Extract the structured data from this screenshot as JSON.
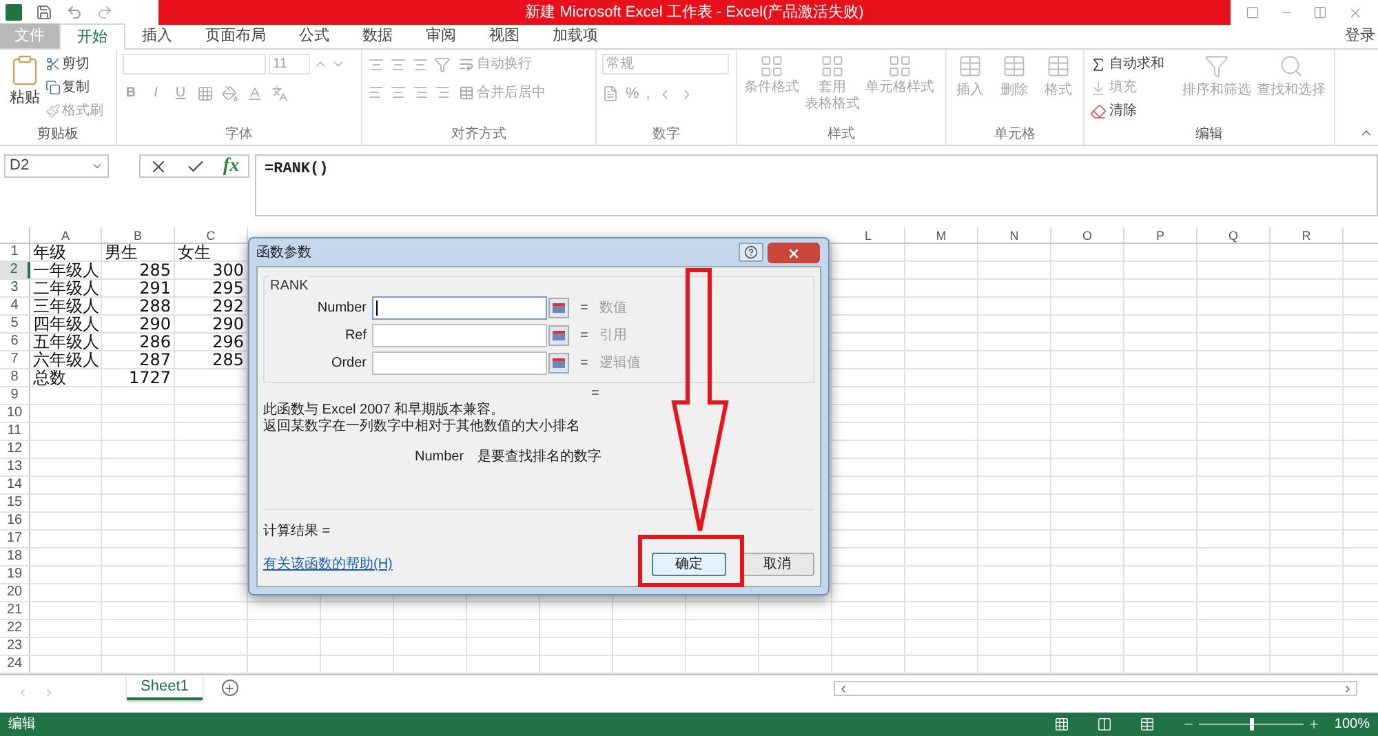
{
  "title_bar": {
    "title": "新建 Microsoft Excel 工作表 - Excel(产品激活失败)"
  },
  "tabs": [
    {
      "label": "文件",
      "selected": false,
      "kind": "file"
    },
    {
      "label": "开始",
      "selected": true,
      "kind": "tab"
    },
    {
      "label": "插入",
      "selected": false,
      "kind": "tab"
    },
    {
      "label": "页面布局",
      "selected": false,
      "kind": "tab"
    },
    {
      "label": "公式",
      "selected": false,
      "kind": "tab"
    },
    {
      "label": "数据",
      "selected": false,
      "kind": "tab"
    },
    {
      "label": "审阅",
      "selected": false,
      "kind": "tab"
    },
    {
      "label": "视图",
      "selected": false,
      "kind": "tab"
    },
    {
      "label": "加载项",
      "selected": false,
      "kind": "tab"
    }
  ],
  "account": "登录",
  "ribbon": {
    "clipboard": {
      "label": "剪贴板",
      "paste": {
        "label": "粘贴",
        "disabled": false
      },
      "items": [
        {
          "label": "剪切",
          "disabled": false
        },
        {
          "label": "复制",
          "disabled": false
        },
        {
          "label": "格式刷",
          "disabled": true
        }
      ]
    },
    "font": {
      "label": "字体",
      "disabled": true,
      "size": "11",
      "style_buttons": [
        "B",
        "I",
        "U"
      ]
    },
    "alignment": {
      "label": "对齐方式",
      "disabled": true,
      "items": [
        "自动换行",
        "合并后居中"
      ]
    },
    "number": {
      "label": "数字",
      "disabled": true,
      "format": "常规",
      "symbols": [
        "%",
        ","
      ]
    },
    "styles": {
      "label": "样式",
      "disabled": true,
      "items": [
        {
          "lines": [
            "条件格式"
          ]
        },
        {
          "lines": [
            "套用",
            "表格格式"
          ]
        },
        {
          "lines": [
            "单元格样式"
          ]
        }
      ]
    },
    "cells": {
      "label": "单元格",
      "disabled": true,
      "items": [
        "插入",
        "删除",
        "格式"
      ]
    },
    "editing": {
      "label": "编辑",
      "items": [
        {
          "label": "自动求和",
          "disabled": false
        },
        {
          "label": "填充",
          "disabled": true
        },
        {
          "label": "清除",
          "disabled": false
        }
      ],
      "big_items": [
        {
          "label": "排序和筛选",
          "disabled": true
        },
        {
          "label": "查找和选择",
          "disabled": true
        }
      ]
    }
  },
  "formula_bar": {
    "name_box": "D2",
    "function_label": "fx",
    "formula": "=RANK()"
  },
  "sheet": {
    "column_headers_left": [
      "A",
      "B",
      "C"
    ],
    "column_headers_right": [
      "L",
      "M",
      "N",
      "O",
      "P",
      "Q",
      "R"
    ],
    "rows": [
      {
        "number": "1",
        "selected": false,
        "cells": [
          {
            "text": "年级",
            "kind": "text"
          },
          {
            "text": "男生",
            "kind": "text"
          },
          {
            "text": "女生",
            "kind": "text"
          }
        ]
      },
      {
        "number": "2",
        "selected": true,
        "cells": [
          {
            "text": "一年级人",
            "kind": "text"
          },
          {
            "text": "285",
            "kind": "number"
          },
          {
            "text": "300",
            "kind": "number"
          }
        ]
      },
      {
        "number": "3",
        "selected": false,
        "cells": [
          {
            "text": "二年级人",
            "kind": "text"
          },
          {
            "text": "291",
            "kind": "number"
          },
          {
            "text": "295",
            "kind": "number"
          }
        ]
      },
      {
        "number": "4",
        "selected": false,
        "cells": [
          {
            "text": "三年级人",
            "kind": "text"
          },
          {
            "text": "288",
            "kind": "number"
          },
          {
            "text": "292",
            "kind": "number"
          }
        ]
      },
      {
        "number": "5",
        "selected": false,
        "cells": [
          {
            "text": "四年级人",
            "kind": "text"
          },
          {
            "text": "290",
            "kind": "number"
          },
          {
            "text": "290",
            "kind": "number"
          }
        ]
      },
      {
        "number": "6",
        "selected": false,
        "cells": [
          {
            "text": "五年级人",
            "kind": "text"
          },
          {
            "text": "286",
            "kind": "number"
          },
          {
            "text": "296",
            "kind": "number"
          }
        ]
      },
      {
        "number": "7",
        "selected": false,
        "cells": [
          {
            "text": "六年级人",
            "kind": "text"
          },
          {
            "text": "287",
            "kind": "number"
          },
          {
            "text": "285",
            "kind": "number"
          }
        ]
      },
      {
        "number": "8",
        "selected": false,
        "cells": [
          {
            "text": "总数",
            "kind": "text"
          },
          {
            "text": "1727",
            "kind": "number"
          }
        ]
      },
      {
        "number": "9",
        "selected": false
      },
      {
        "number": "10",
        "selected": false
      },
      {
        "number": "11",
        "selected": false
      },
      {
        "number": "12",
        "selected": false
      },
      {
        "number": "13",
        "selected": false
      },
      {
        "number": "14",
        "selected": false
      },
      {
        "number": "15",
        "selected": false
      },
      {
        "number": "16",
        "selected": false
      },
      {
        "number": "17",
        "selected": false
      },
      {
        "number": "18",
        "selected": false
      },
      {
        "number": "19",
        "selected": false
      },
      {
        "number": "20",
        "selected": false
      },
      {
        "number": "21",
        "selected": false
      },
      {
        "number": "22",
        "selected": false
      },
      {
        "number": "23",
        "selected": false
      },
      {
        "number": "24",
        "selected": false
      }
    ]
  },
  "dialog": {
    "title": "函数参数",
    "function_name": "RANK",
    "arguments": [
      {
        "label": "Number",
        "sign": "=",
        "value_hint": "数值",
        "focused": true
      },
      {
        "label": "Ref",
        "sign": "=",
        "value_hint": "引用",
        "focused": false
      },
      {
        "label": "Order",
        "sign": "=",
        "value_hint": "逻辑值",
        "focused": false
      }
    ],
    "equals": "=",
    "description": [
      "此函数与 Excel 2007 和早期版本兼容。",
      "返回某数字在一列数字中相对于其他数值的大小排名"
    ],
    "argument_help": {
      "name": "Number",
      "text": "是要查找排名的数字"
    },
    "result_label": "计算结果 =",
    "help_link": "有关该函数的帮助(H)",
    "buttons": [
      {
        "label": "确定",
        "kind": "primary"
      },
      {
        "label": "取消",
        "kind": "secondary"
      }
    ]
  },
  "sheet_tabs": [
    {
      "label": "Sheet1",
      "selected": true
    }
  ],
  "status_bar": {
    "mode": "编辑",
    "zoom": {
      "level": 0.5,
      "reading": "100%"
    }
  },
  "annotations": [
    {
      "kind": "arrow"
    },
    {
      "kind": "frame"
    }
  ]
}
